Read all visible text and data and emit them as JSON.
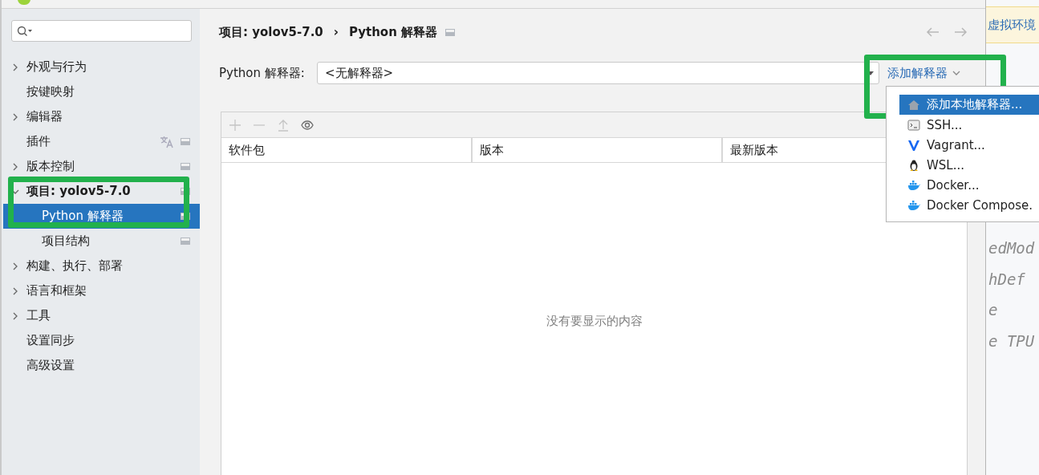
{
  "sidebar": {
    "items": [
      {
        "label": "外观与行为",
        "expanded": false,
        "selected": false
      },
      {
        "label": "按键映射",
        "selected": false
      },
      {
        "label": "编辑器",
        "expanded": false,
        "selected": false
      },
      {
        "label": "插件",
        "selected": false,
        "badges": [
          {
            "kind": "translate"
          },
          {
            "kind": "project"
          }
        ]
      },
      {
        "label": "版本控制",
        "expanded": false,
        "selected": false,
        "badges": [
          {
            "kind": "project"
          }
        ]
      },
      {
        "label": "项目: yolov5-7.0",
        "expanded": true,
        "selected": false,
        "badges": [
          {
            "kind": "project"
          }
        ],
        "children": [
          {
            "label": "Python 解释器",
            "selected": true,
            "badges": [
              {
                "kind": "project"
              }
            ]
          },
          {
            "label": "项目结构",
            "selected": false,
            "badges": [
              {
                "kind": "project"
              }
            ]
          }
        ]
      },
      {
        "label": "构建、执行、部署",
        "expanded": false,
        "selected": false
      },
      {
        "label": "语言和框架",
        "expanded": false,
        "selected": false
      },
      {
        "label": "工具",
        "expanded": false,
        "selected": false
      },
      {
        "label": "设置同步",
        "selected": false
      },
      {
        "label": "高级设置",
        "selected": false
      }
    ]
  },
  "breadcrumb": {
    "parent": "项目: yolov5-7.0",
    "separator": "›",
    "current": "Python 解释器"
  },
  "interpreter": {
    "label": "Python 解释器:",
    "value": "<无解释器>",
    "add_button": "添加解释器"
  },
  "packages": {
    "toolbar": [
      {
        "kind": "add",
        "disabled": true
      },
      {
        "kind": "remove",
        "disabled": true
      },
      {
        "kind": "upgrade",
        "disabled": true
      },
      {
        "kind": "eye",
        "disabled": false
      }
    ],
    "columns": [
      "软件包",
      "版本",
      "最新版本"
    ],
    "empty_text": "没有要显示的内容"
  },
  "add_menu": {
    "items": [
      {
        "label": "添加本地解释器...",
        "kind": "local",
        "selected": true
      },
      {
        "label": "SSH...",
        "kind": "ssh",
        "selected": false
      },
      {
        "label": "Vagrant...",
        "kind": "vagrant",
        "selected": false
      },
      {
        "label": "WSL...",
        "kind": "wsl",
        "selected": false
      },
      {
        "label": "Docker...",
        "kind": "docker",
        "selected": false
      },
      {
        "label": "Docker Compose.",
        "kind": "docker",
        "selected": false
      }
    ]
  },
  "editor": {
    "banner": "虚拟环境",
    "code_lines": [
      "edMod",
      "hDef",
      "e",
      "e TPU"
    ]
  }
}
